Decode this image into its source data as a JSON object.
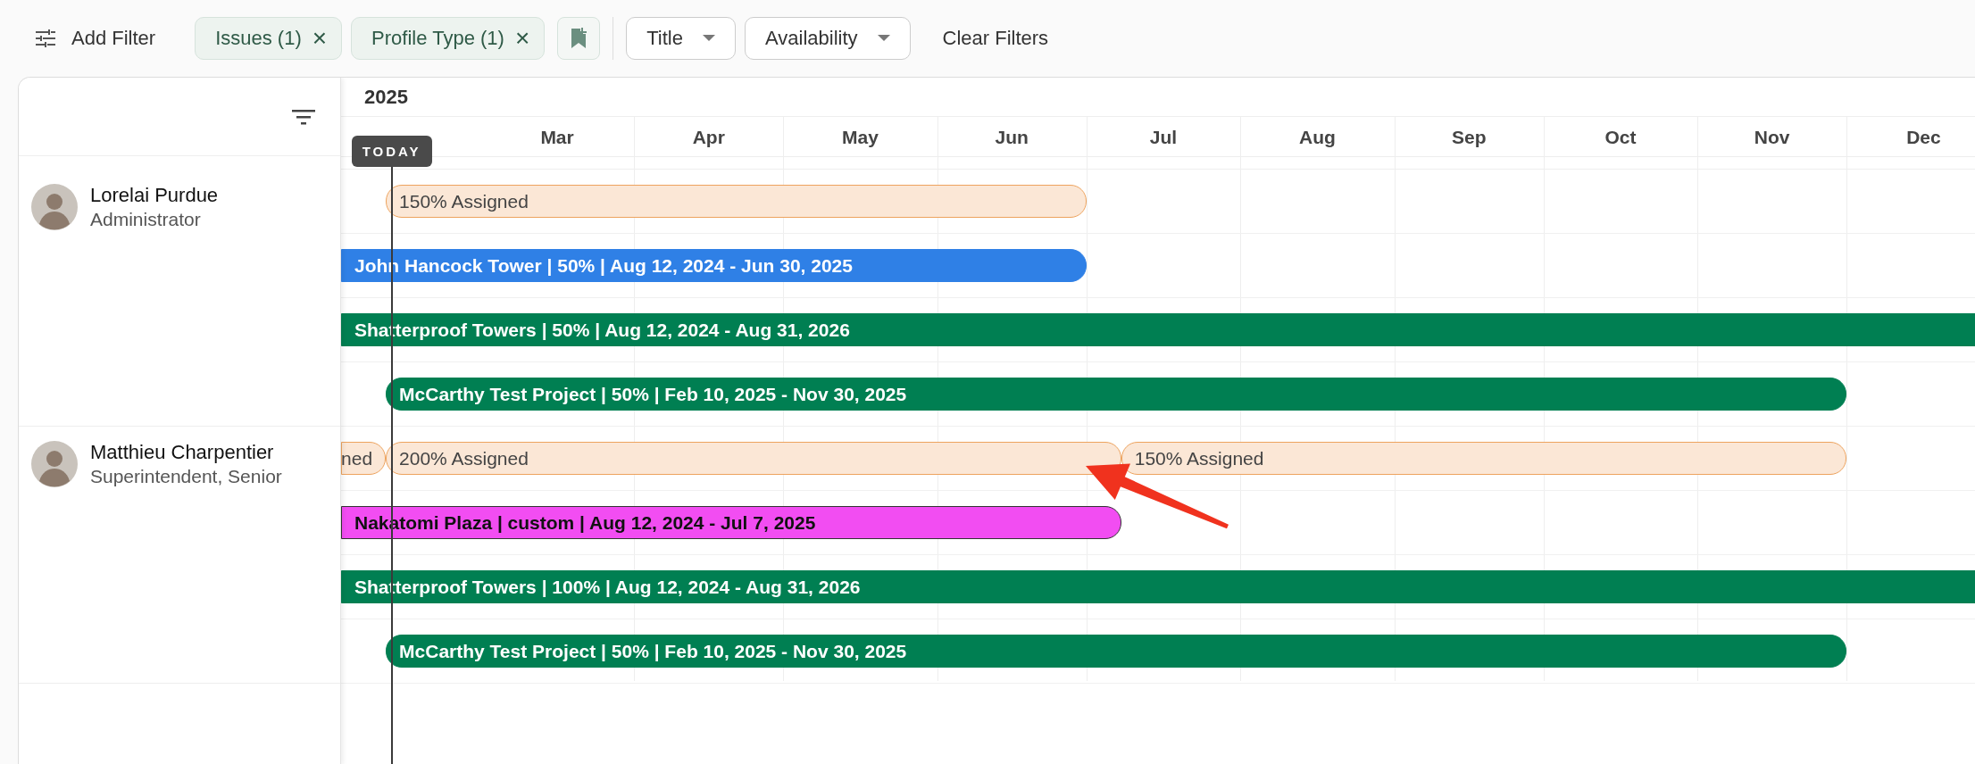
{
  "toolbar": {
    "add_filter": "Add Filter",
    "chips": [
      {
        "label": "Issues (1)",
        "close": "×"
      },
      {
        "label": "Profile Type (1)",
        "close": "×"
      }
    ],
    "dropdowns": [
      {
        "label": "Title"
      },
      {
        "label": "Availability"
      }
    ],
    "clear": "Clear Filters"
  },
  "timeline": {
    "year": "2025",
    "today_label": "TODAY",
    "months": [
      {
        "label": "Mar"
      },
      {
        "label": "Apr"
      },
      {
        "label": "May"
      },
      {
        "label": "Jun"
      },
      {
        "label": "Jul"
      },
      {
        "label": "Aug"
      },
      {
        "label": "Sep"
      },
      {
        "label": "Oct"
      },
      {
        "label": "Nov"
      },
      {
        "label": "Dec"
      }
    ]
  },
  "people": [
    {
      "name": "Lorelai Purdue",
      "title": "Administrator",
      "rows": [
        {
          "bars": [
            {
              "kind": "assigned",
              "label": "150% Assigned"
            }
          ]
        },
        {
          "bars": [
            {
              "kind": "project",
              "label": "John Hancock Tower | 50% | Aug 12, 2024 - Jun 30, 2025",
              "color": "#2f80e6"
            }
          ]
        },
        {
          "bars": [
            {
              "kind": "project",
              "label": "Shatterproof Towers | 50% | Aug 12, 2024 - Aug 31, 2026",
              "color": "#007f52"
            }
          ]
        },
        {
          "bars": [
            {
              "kind": "project",
              "label": "McCarthy Test Project | 50% | Feb 10, 2025 - Nov 30, 2025",
              "color": "#007f52"
            }
          ]
        }
      ]
    },
    {
      "name": "Matthieu Charpentier",
      "title": "Superintendent, Senior",
      "rows": [
        {
          "bars": [
            {
              "kind": "assigned",
              "label": "ned"
            },
            {
              "kind": "assigned",
              "label": "200% Assigned"
            },
            {
              "kind": "assigned",
              "label": "150% Assigned"
            }
          ]
        },
        {
          "bars": [
            {
              "kind": "project",
              "label": "Nakatomi Plaza | custom | Aug 12, 2024 - Jul 7, 2025",
              "color": "#f24df2"
            }
          ]
        },
        {
          "bars": [
            {
              "kind": "project",
              "label": "Shatterproof Towers | 100% | Aug 12, 2024 - Aug 31, 2026",
              "color": "#007f52"
            }
          ]
        },
        {
          "bars": [
            {
              "kind": "project",
              "label": "McCarthy Test Project | 50% | Feb 10, 2025 - Nov 30, 2025",
              "color": "#007f52"
            }
          ]
        }
      ]
    }
  ]
}
